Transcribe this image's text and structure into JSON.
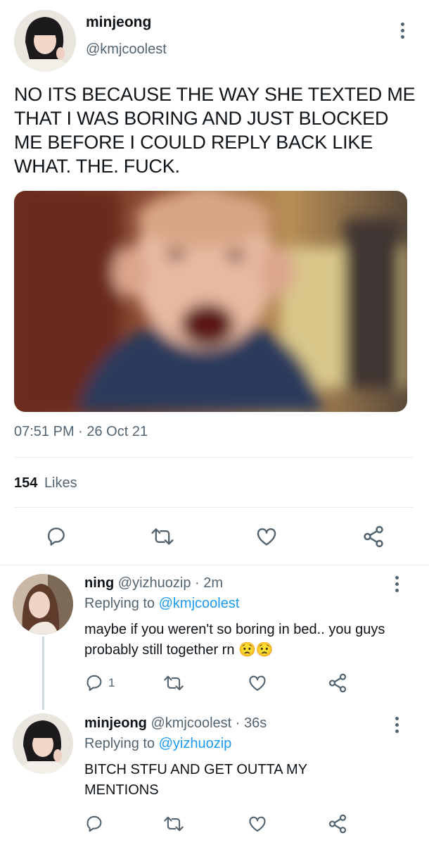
{
  "main_tweet": {
    "author_name": "minjeong",
    "author_handle": "@kmjcoolest",
    "text": "NO ITS BECAUSE THE WAY SHE TEXTED ME THAT I WAS BORING AND JUST BLOCKED ME BEFORE I COULD REPLY BACK LIKE WHAT. THE. FUCK.",
    "timestamp": "07:51 PM · 26 Oct 21",
    "likes_count": "154",
    "likes_label": "Likes"
  },
  "replies": [
    {
      "author_name": "ning",
      "author_handle": "@yizhuozip",
      "sep": "·",
      "time": "2m",
      "replying_prefix": "Replying to",
      "replying_to": "@kmjcoolest",
      "text": "maybe if you weren't so boring in bed.. you guys probably still together rn",
      "emoji": "😟😟",
      "reply_count": "1"
    },
    {
      "author_name": "minjeong",
      "author_handle": "@kmjcoolest",
      "sep": "·",
      "time": "36s",
      "replying_prefix": "Replying to",
      "replying_to": "@yizhuozip",
      "text": "BITCH STFU AND GET OUTTA MY MENTIONS",
      "reply_count": ""
    }
  ],
  "icons": [
    "reply-icon",
    "retweet-icon",
    "like-icon",
    "share-icon",
    "more-icon"
  ],
  "colors": {
    "accent": "#1d9bf0",
    "secondary_text": "#536471",
    "divider": "#e6ecf0"
  }
}
